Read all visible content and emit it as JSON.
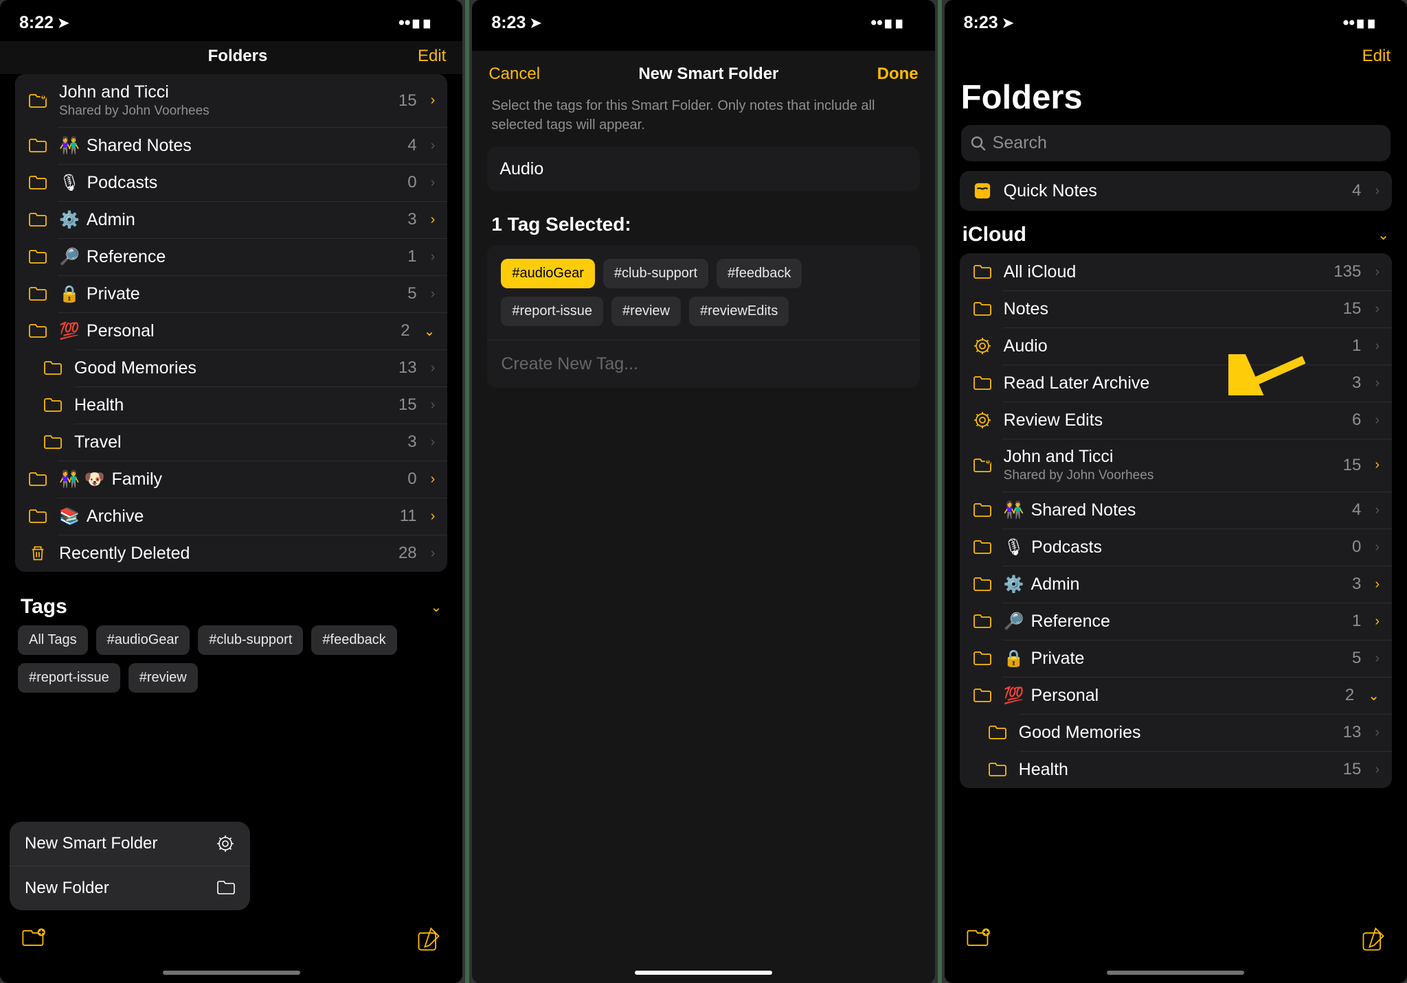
{
  "pane1": {
    "time": "8:22",
    "nav_title": "Folders",
    "nav_edit": "Edit",
    "folders": [
      {
        "name": "John and Ticci",
        "sub": "Shared by John Voorhees",
        "count": 15,
        "icon": "shared-folder",
        "chev": "yellow"
      },
      {
        "name": "Shared Notes",
        "emoji": "👫",
        "count": 4,
        "icon": "folder"
      },
      {
        "name": "Podcasts",
        "emoji": "🎙",
        "count": 0,
        "icon": "folder"
      },
      {
        "name": "Admin",
        "emoji": "⚙️",
        "count": 3,
        "icon": "folder",
        "chev": "yellow"
      },
      {
        "name": "Reference",
        "emoji": "🔎",
        "count": 1,
        "icon": "folder"
      },
      {
        "name": "Private",
        "emoji": "🔒",
        "count": 5,
        "icon": "folder"
      },
      {
        "name": "Personal",
        "emoji": "💯",
        "count": 2,
        "icon": "folder",
        "chev": "yellow-down"
      },
      {
        "name": "Good Memories",
        "count": 13,
        "icon": "folder",
        "nested": true
      },
      {
        "name": "Health",
        "count": 15,
        "icon": "folder",
        "nested": true
      },
      {
        "name": "Travel",
        "count": 3,
        "icon": "folder",
        "nested": true
      },
      {
        "name": "Family",
        "emoji": "👫 🐶",
        "count": 0,
        "icon": "folder",
        "chev": "yellow"
      },
      {
        "name": "Archive",
        "emoji": "📚",
        "count": 11,
        "icon": "folder",
        "chev": "yellow"
      },
      {
        "name": "Recently Deleted",
        "count": 28,
        "icon": "trash"
      }
    ],
    "tags_header": "Tags",
    "tags": [
      "All Tags",
      "#audioGear",
      "#club-support",
      "#feedback",
      "#report-issue",
      "#review"
    ],
    "popup": {
      "smart": "New Smart Folder",
      "folder": "New Folder"
    }
  },
  "pane2": {
    "time": "8:23",
    "nav_cancel": "Cancel",
    "nav_title": "New Smart Folder",
    "nav_done": "Done",
    "desc": "Select the tags for this Smart Folder. Only notes that include all selected tags will appear.",
    "name_value": "Audio",
    "selected_header": "1 Tag Selected:",
    "tags": [
      {
        "t": "#audioGear",
        "sel": true
      },
      {
        "t": "#club-support"
      },
      {
        "t": "#feedback"
      },
      {
        "t": "#report-issue"
      },
      {
        "t": "#review"
      },
      {
        "t": "#reviewEdits"
      }
    ],
    "create_placeholder": "Create New Tag..."
  },
  "pane3": {
    "time": "8:23",
    "nav_edit": "Edit",
    "title": "Folders",
    "search_placeholder": "Search",
    "quick": {
      "label": "Quick Notes",
      "count": 4
    },
    "section": "iCloud",
    "folders": [
      {
        "name": "All iCloud",
        "count": 135,
        "icon": "folder"
      },
      {
        "name": "Notes",
        "count": 15,
        "icon": "folder"
      },
      {
        "name": "Audio",
        "count": 1,
        "icon": "gear"
      },
      {
        "name": "Read Later Archive",
        "count": 3,
        "icon": "folder"
      },
      {
        "name": "Review Edits",
        "count": 6,
        "icon": "gear"
      },
      {
        "name": "John and Ticci",
        "sub": "Shared by John Voorhees",
        "count": 15,
        "icon": "shared-folder",
        "chev": "yellow"
      },
      {
        "name": "Shared Notes",
        "emoji": "👫",
        "count": 4,
        "icon": "folder"
      },
      {
        "name": "Podcasts",
        "emoji": "🎙",
        "count": 0,
        "icon": "folder"
      },
      {
        "name": "Admin",
        "emoji": "⚙️",
        "count": 3,
        "icon": "folder",
        "chev": "yellow"
      },
      {
        "name": "Reference",
        "emoji": "🔎",
        "count": 1,
        "icon": "folder",
        "chev": "yellow"
      },
      {
        "name": "Private",
        "emoji": "🔒",
        "count": 5,
        "icon": "folder"
      },
      {
        "name": "Personal",
        "emoji": "💯",
        "count": 2,
        "icon": "folder",
        "chev": "yellow-down"
      },
      {
        "name": "Good Memories",
        "count": 13,
        "icon": "folder",
        "nested": true
      },
      {
        "name": "Health",
        "count": 15,
        "icon": "folder",
        "nested": true
      }
    ]
  }
}
